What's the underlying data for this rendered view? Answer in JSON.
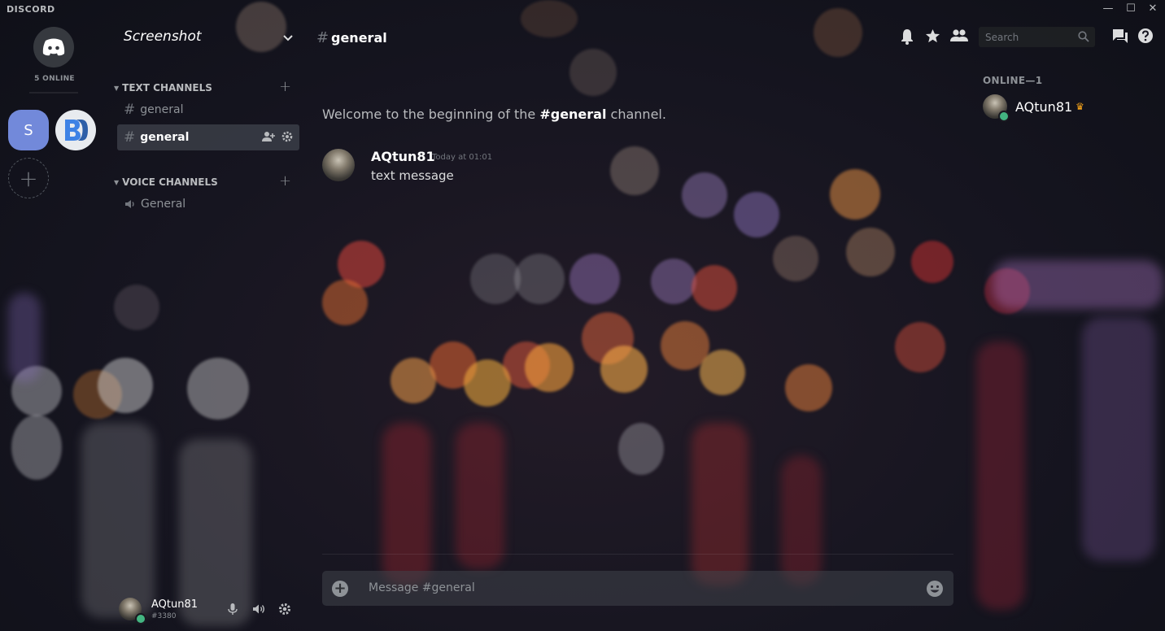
{
  "app": {
    "logo_text": "DISCORD"
  },
  "window_controls": {
    "minimize": "—",
    "maximize": "☐",
    "close": "✕"
  },
  "servers": {
    "online_count": "5 ONLINE",
    "items": [
      {
        "initial": "S"
      },
      {
        "initial": ""
      }
    ],
    "add_symbol": "+"
  },
  "guild": {
    "name": "Screenshot"
  },
  "categories": {
    "text": {
      "label": "TEXT CHANNELS"
    },
    "voice": {
      "label": "VOICE CHANNELS"
    }
  },
  "channels": {
    "text": [
      {
        "name": "general"
      },
      {
        "name": "general"
      }
    ],
    "voice": [
      {
        "name": "General"
      }
    ]
  },
  "user": {
    "name": "AQtun81",
    "tag": "#3380"
  },
  "header": {
    "hash": "#",
    "channel": "general"
  },
  "search": {
    "placeholder": "Search"
  },
  "chat": {
    "welcome_prefix": "Welcome to the beginning of the ",
    "welcome_channel": "#general",
    "welcome_suffix": " channel.",
    "messages": [
      {
        "author": "AQtun81",
        "timestamp": "Today at 01:01",
        "text": "text message"
      }
    ],
    "composer_placeholder": "Message #general"
  },
  "members": {
    "header": "ONLINE—1",
    "list": [
      {
        "name": "AQtun81",
        "badge": "♛"
      }
    ]
  },
  "colors": {
    "accent": "#7289da",
    "online": "#43b581",
    "crown": "#faa61a"
  }
}
